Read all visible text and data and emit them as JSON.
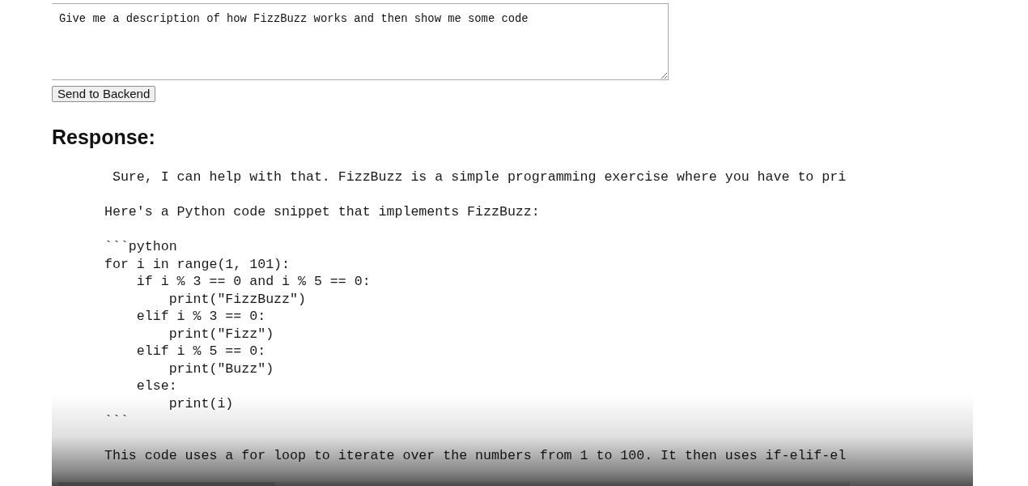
{
  "prompt_field": {
    "value": "Give me a description of how FizzBuzz works and then show me some code"
  },
  "send_button": {
    "label": "Send to Backend"
  },
  "response": {
    "heading": "Response:",
    "blocks": [
      {
        "lines": [
          " Sure, I can help with that. FizzBuzz is a simple programming exercise where you have to pri"
        ]
      },
      {
        "lines": [
          "Here's a Python code snippet that implements FizzBuzz:"
        ]
      },
      {
        "lines": [
          "```python",
          "for i in range(1, 101):",
          "    if i % 3 == 0 and i % 5 == 0:",
          "        print(\"FizzBuzz\")",
          "    elif i % 3 == 0:",
          "        print(\"Fizz\")",
          "    elif i % 5 == 0:",
          "        print(\"Buzz\")",
          "    else:",
          "        print(i)",
          "```"
        ]
      },
      {
        "lines": [
          "This code uses a for loop to iterate over the numbers from 1 to 100. It then uses if-elif-el"
        ]
      }
    ]
  }
}
